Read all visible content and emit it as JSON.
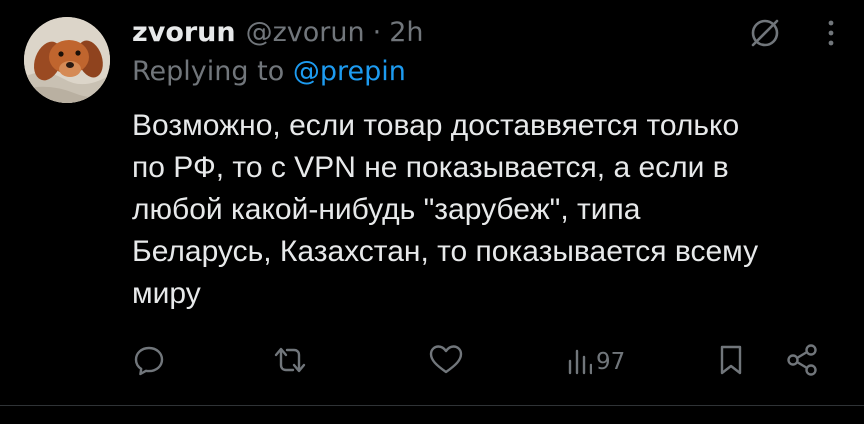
{
  "tweet": {
    "author": {
      "display_name": "zvorun",
      "handle": "@zvorun",
      "separator": "·",
      "time": "2h"
    },
    "reply": {
      "prefix": "Replying to",
      "handle": "@prepin"
    },
    "text": "Возможно, если товар доставвяется только\nпо РФ, то с VPN не показывается, а если в\nлюбой какой-нибудь \"зарубеж\", типа\nБеларусь, Казахстан, то показывается всему\nмиру",
    "actions": {
      "views_count": "97"
    },
    "icons": {
      "avatar": "dog-avatar",
      "grok": "slashed-circle-icon",
      "more": "more-vertical-icon",
      "reply": "reply-icon",
      "retweet": "retweet-icon",
      "like": "heart-icon",
      "views": "views-bar-icon",
      "bookmark": "bookmark-icon",
      "share": "share-icon"
    }
  },
  "colors": {
    "background": "#000000",
    "text_primary": "#e7e9ea",
    "text_secondary": "#71767b",
    "link": "#1d9bf0",
    "divider": "#2f3336"
  }
}
